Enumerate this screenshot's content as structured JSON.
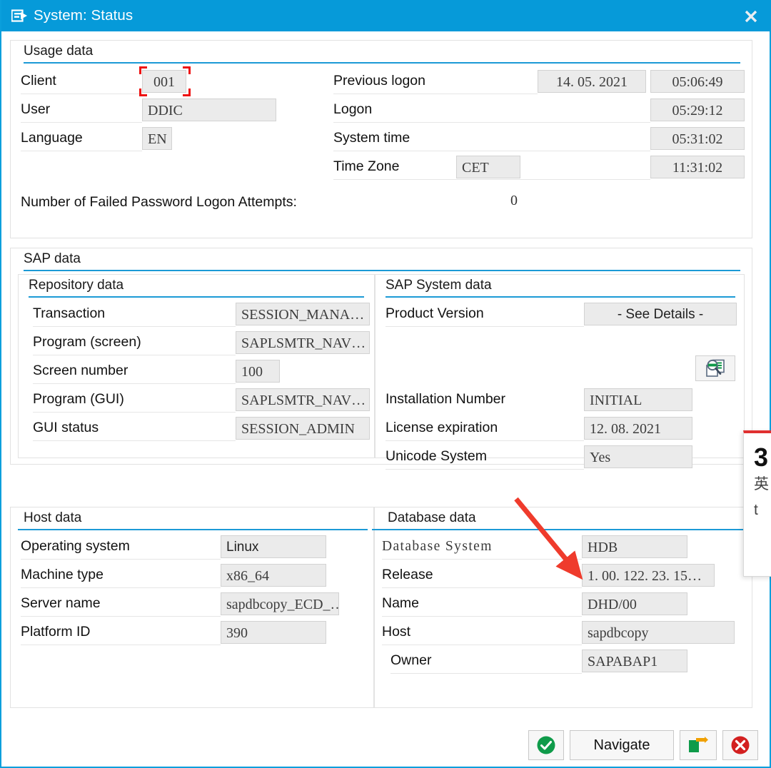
{
  "window": {
    "title": "System: Status",
    "title_icon": "window-list-icon",
    "close_icon": "close-icon",
    "accent_color": "#069ad9"
  },
  "usage_data": {
    "heading": "Usage data",
    "left_rows": [
      {
        "label": "Client",
        "value": "001",
        "focused": true
      },
      {
        "label": "User",
        "value": "DDIC",
        "focused": false
      },
      {
        "label": "Language",
        "value": "EN",
        "focused": false
      }
    ],
    "right_rows": [
      {
        "label": "Previous logon",
        "date": "14. 05. 2021",
        "time": "05:06:49"
      },
      {
        "label": "Logon",
        "date": "",
        "time": "05:29:12"
      },
      {
        "label": "System time",
        "date": "",
        "time": "05:31:02"
      },
      {
        "label": "Time Zone",
        "date": "CET",
        "time": "11:31:02"
      }
    ],
    "failed_logons_label": "Number of Failed Password Logon Attempts:",
    "failed_logons_value": "0"
  },
  "sap_data": {
    "heading": "SAP data",
    "repository": {
      "heading": "Repository data",
      "rows": [
        {
          "label": "Transaction",
          "value": "SESSION_MANA…"
        },
        {
          "label": "Program (screen)",
          "value": "SAPLSMTR_NAV…"
        },
        {
          "label": "Screen number",
          "value": "100"
        },
        {
          "label": "Program (GUI)",
          "value": "SAPLSMTR_NAV…"
        },
        {
          "label": "GUI status",
          "value": "SESSION_ADMIN"
        }
      ]
    },
    "system": {
      "heading": "SAP System data",
      "product_version_label": "Product Version",
      "product_version_value": "- See Details -",
      "details_icon": "magnifier-details-icon",
      "rows": [
        {
          "label": "Installation Number",
          "value": "INITIAL"
        },
        {
          "label": "License expiration",
          "value": "12. 08. 2021"
        },
        {
          "label": "Unicode System",
          "value": "Yes"
        }
      ]
    }
  },
  "host_data": {
    "heading": "Host data",
    "rows": [
      {
        "label": "Operating system",
        "value": "Linux"
      },
      {
        "label": "Machine type",
        "value": "x86_64"
      },
      {
        "label": "Server name",
        "value": "sapdbcopy_ECD_…"
      },
      {
        "label": "Platform ID",
        "value": "390"
      }
    ]
  },
  "database_data": {
    "heading": "Database data",
    "rows": [
      {
        "label": "Database System",
        "value": "HDB",
        "label_style": "serif"
      },
      {
        "label": "Release",
        "value": "1. 00. 122. 23. 15…",
        "label_style": "sans"
      },
      {
        "label": "Name",
        "value": "DHD/00",
        "label_style": "sans"
      },
      {
        "label": "Host",
        "value": "sapdbcopy",
        "label_style": "sans"
      },
      {
        "label": "Owner",
        "value": "SAPABAP1",
        "label_style": "sans"
      }
    ]
  },
  "buttons": {
    "ok": {
      "label": "",
      "icon": "green-check-icon"
    },
    "navigate": {
      "label": "Navigate",
      "icon": ""
    },
    "exit": {
      "label": "",
      "icon": "exit-arrow-icon"
    },
    "cancel": {
      "label": "",
      "icon": "red-cross-icon"
    }
  },
  "annotation": {
    "number": "3",
    "line1": "英",
    "line2": "t",
    "accent_color": "#e03030",
    "arrow_color": "#ef3b2c"
  }
}
